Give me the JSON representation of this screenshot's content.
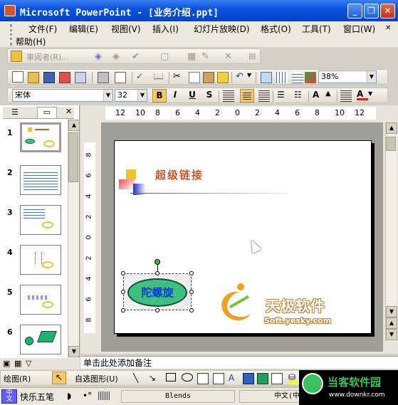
{
  "window": {
    "title": "Microsoft PowerPoint - [业务介绍.ppt]",
    "minimize": "_",
    "restore": "❐",
    "close": "✕"
  },
  "menus": [
    "文件(F)",
    "编辑(E)",
    "视图(V)",
    "插入(I)",
    "幻灯片放映(D)",
    "格式(O)",
    "工具(T)",
    "窗口(W)",
    "帮助(H)"
  ],
  "toolbar_review": {
    "label": "审阅者(R)..."
  },
  "standard": {
    "zoom": "38%"
  },
  "format": {
    "font": "宋体",
    "size": "32",
    "bold": "B",
    "italic": "I",
    "underline": "U",
    "shadow": "S"
  },
  "thumbs": [
    "1",
    "2",
    "3",
    "4",
    "5",
    "6"
  ],
  "ruler_h": [
    "12",
    "10",
    "8",
    "6",
    "4",
    "2",
    "0",
    "2",
    "4",
    "6",
    "8",
    "10",
    "12"
  ],
  "ruler_v": [
    "8",
    "6",
    "4",
    "2",
    "0",
    "2",
    "4",
    "6",
    "8"
  ],
  "slide": {
    "title": "超级链接",
    "button_text": "陀螺旋",
    "logo_cn": "天极软件",
    "logo_en": "Soft.yesky.com"
  },
  "notes": {
    "placeholder": "单击此处添加备注"
  },
  "drawbar": {
    "draw": "绘图(R)",
    "autoshapes": "自选图形(U)"
  },
  "status": {
    "ime": "快乐五笔",
    "template": "Blends",
    "lang": "中文(中"
  },
  "watermark": {
    "cn": "当客软件园",
    "url": "www.downkr.com"
  },
  "colors": {
    "title_blue": "#0542c8",
    "accent_red": "#d9542a",
    "shape_green": "#40c080"
  }
}
